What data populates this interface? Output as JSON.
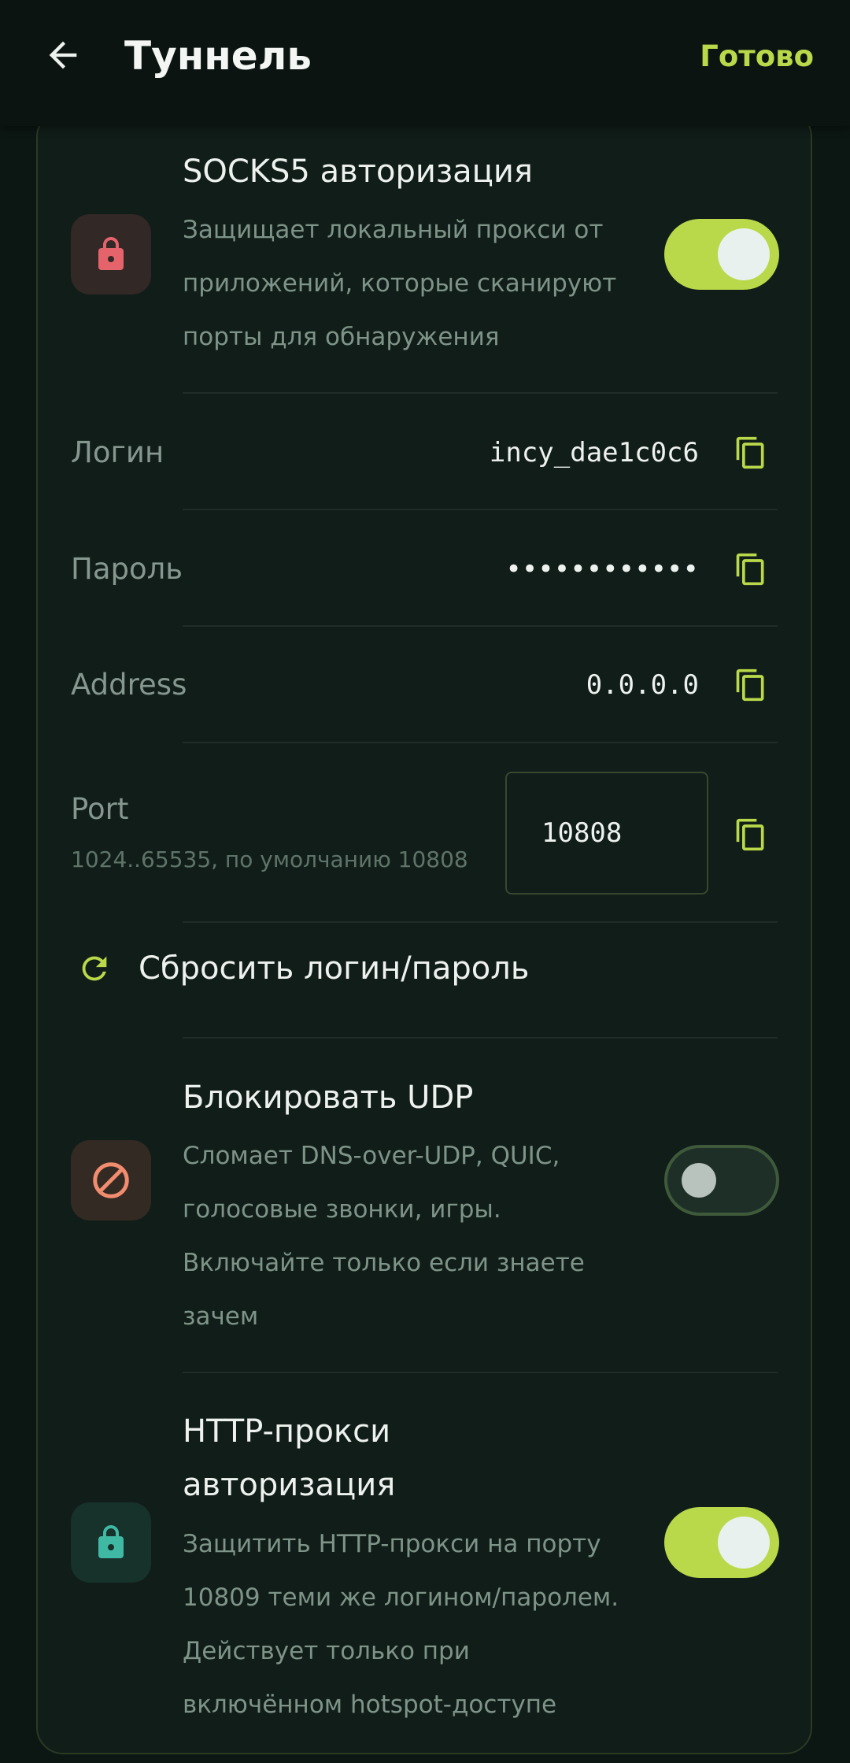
{
  "header": {
    "title": "Туннель",
    "done_label": "Готово",
    "back_icon": "arrow-left-icon"
  },
  "socks5": {
    "title": "SOCKS5 авторизация",
    "desc_lines": [
      "Защищает локальный прокси от",
      "приложений, которые сканируют",
      "порты для обнаружения"
    ],
    "enabled": true,
    "icon": "lock-icon"
  },
  "fields": {
    "login": {
      "label": "Логин",
      "value": "incy_dae1c0c6"
    },
    "password": {
      "label": "Пароль",
      "value": "••••••••••••"
    },
    "address": {
      "label": "Address",
      "value": "0.0.0.0"
    },
    "port": {
      "label": "Port",
      "hint": "1024..65535, по умолчанию 10808",
      "value": "10808"
    }
  },
  "reset": {
    "label": "Сбросить логин/пароль",
    "icon": "refresh-icon"
  },
  "block_udp": {
    "title": "Блокировать UDP",
    "desc_lines": [
      "Сломает DNS-over-UDP, QUIC,",
      "голосовые звонки, игры.",
      "Включайте только если знаете",
      "зачем"
    ],
    "enabled": false,
    "icon": "block-icon"
  },
  "http_proxy": {
    "title_lines": [
      "HTTP-прокси",
      "авторизация"
    ],
    "desc_lines": [
      "Защитить HTTP-прокси на порту",
      "10809 теми же логином/паролем.",
      "Действует только при",
      "включённом hotspot-доступе"
    ],
    "enabled": true,
    "icon": "lock-icon"
  },
  "colors": {
    "accent": "#b9d94a",
    "background": "#0c1613",
    "card": "#111d19",
    "lock_red": "#e5646c",
    "block_orange": "#f28c6e",
    "lock_teal": "#3fb8a4"
  }
}
